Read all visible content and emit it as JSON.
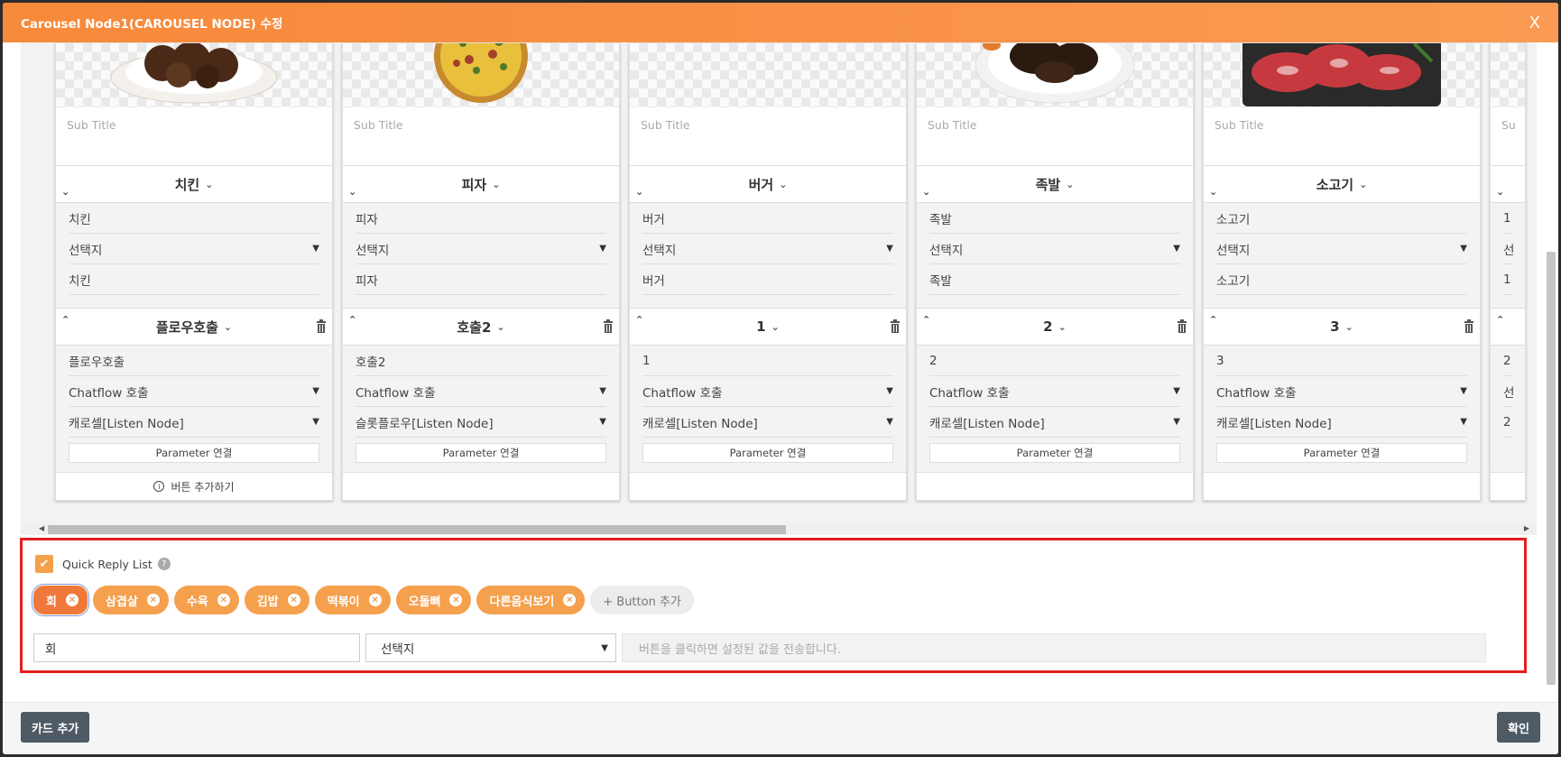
{
  "modal": {
    "title": "Carousel Node1(CAROUSEL NODE) 수정",
    "close_label": "X",
    "footer": {
      "add_card_label": "카드 추가",
      "confirm_label": "확인"
    }
  },
  "cards": [
    {
      "food": "chicken",
      "subtitle_placeholder": "Sub Title",
      "title": "치킨",
      "title_value": "치킨",
      "type": "선택지",
      "value": "치킨",
      "button": {
        "label": "플로우호출",
        "value": "플로우호출",
        "type": "Chatflow 호출",
        "target": "캐로셀[Listen Node]",
        "param_label": "Parameter 연결"
      },
      "add_button_label": "버튼 추가하기"
    },
    {
      "food": "pizza",
      "subtitle_placeholder": "Sub Title",
      "title": "피자",
      "title_value": "피자",
      "type": "선택지",
      "value": "피자",
      "button": {
        "label": "호출2",
        "value": "호출2",
        "type": "Chatflow 호출",
        "target": "슬롯플로우[Listen Node]",
        "param_label": "Parameter 연결"
      }
    },
    {
      "food": "none",
      "subtitle_placeholder": "Sub Title",
      "title": "버거",
      "title_value": "버거",
      "type": "선택지",
      "value": "버거",
      "button": {
        "label": "1",
        "value": "1",
        "type": "Chatflow 호출",
        "target": "캐로셀[Listen Node]",
        "param_label": "Parameter 연결"
      }
    },
    {
      "food": "jokbal",
      "subtitle_placeholder": "Sub Title",
      "title": "족발",
      "title_value": "족발",
      "type": "선택지",
      "value": "족발",
      "button": {
        "label": "2",
        "value": "2",
        "type": "Chatflow 호출",
        "target": "캐로셀[Listen Node]",
        "param_label": "Parameter 연결"
      }
    },
    {
      "food": "beef",
      "subtitle_placeholder": "Sub Title",
      "title": "소고기",
      "title_value": "소고기",
      "type": "선택지",
      "value": "소고기",
      "button": {
        "label": "3",
        "value": "3",
        "type": "Chatflow 호출",
        "target": "캐로셀[Listen Node]",
        "param_label": "Parameter 연결"
      }
    }
  ],
  "partial_card": {
    "sub": "Su",
    "r1": "1",
    "r2": "선",
    "r3": "1",
    "b1": "2",
    "b2": "선",
    "b3": "2"
  },
  "quick_reply": {
    "label": "Quick Reply List",
    "help": "?",
    "checked": true,
    "chips": [
      "회",
      "삼겹살",
      "수육",
      "김밥",
      "떡볶이",
      "오돌뼈",
      "다른음식보기"
    ],
    "add_label": "+ Button 추가",
    "selected_value": "회",
    "select_value": "선택지",
    "hint_placeholder": "버튼을 클릭하면 설정된 값을 전송합니다."
  },
  "colors": {
    "header": "#f7893a",
    "chip": "#f5a04d",
    "highlight": "#e31e1e",
    "button": "#4e5a64"
  }
}
